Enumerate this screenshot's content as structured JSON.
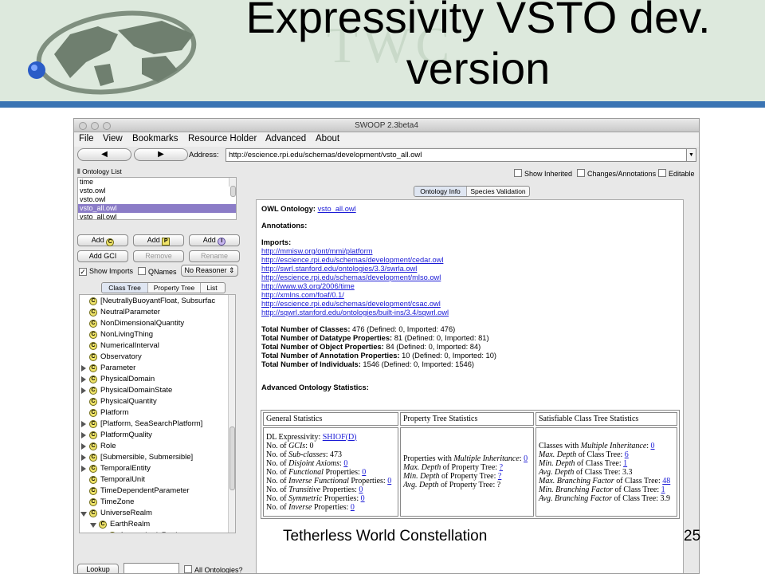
{
  "slide": {
    "title_line1": "Expressivity VSTO dev.",
    "title_line2": "version",
    "watermark": "TWC",
    "footer_left": "Tetherless World Constellation",
    "page_number": "25"
  },
  "window": {
    "title": "SWOOP 2.3beta4",
    "menu": [
      "File",
      "View",
      "Bookmarks",
      "Resource Holder",
      "Advanced",
      "About"
    ],
    "address_label": "Address:",
    "address_value": "http://escience.rpi.edu/schemas/development/vsto_all.owl"
  },
  "left_panel": {
    "ontology_list_label": "Ontology List",
    "ontologies": [
      "time",
      "vsto.owl",
      "vsto.owl",
      "vsto_all.owl",
      "vsto_all.owl"
    ],
    "selected_index": 3,
    "buttons": {
      "add_c": "Add",
      "add_p": "Add",
      "add_i": "Add",
      "add_gci": "Add GCI",
      "remove": "Remove",
      "rename": "Rename",
      "lookup": "Lookup"
    },
    "icons": {
      "c": "C",
      "p": "P",
      "i": "I"
    },
    "show_imports": "Show Imports",
    "qnames": "QNames",
    "reasoner": "No Reasoner",
    "tabs": [
      "Class Tree",
      "Property Tree",
      "List"
    ],
    "all_ontologies": "All Ontologies?",
    "tree": [
      {
        "label": "[NeutrallyBuoyantFloat, Subsurfac",
        "expandable": false
      },
      {
        "label": "NeutralParameter",
        "expandable": false
      },
      {
        "label": "NonDimensionalQuantity",
        "expandable": false
      },
      {
        "label": "NonLivingThing",
        "expandable": false
      },
      {
        "label": "NumericalInterval",
        "expandable": false
      },
      {
        "label": "Observatory",
        "expandable": false
      },
      {
        "label": "Parameter",
        "expandable": true
      },
      {
        "label": "PhysicalDomain",
        "expandable": true
      },
      {
        "label": "PhysicalDomainState",
        "expandable": true
      },
      {
        "label": "PhysicalQuantity",
        "expandable": false
      },
      {
        "label": "Platform",
        "expandable": false
      },
      {
        "label": "[Platform, SeaSearchPlatform]",
        "expandable": true
      },
      {
        "label": "PlatformQuality",
        "expandable": true
      },
      {
        "label": "Role",
        "expandable": true
      },
      {
        "label": "[Submersible, Submersible]",
        "expandable": true
      },
      {
        "label": "TemporalEntity",
        "expandable": true
      },
      {
        "label": "TemporalUnit",
        "expandable": false
      },
      {
        "label": "TimeDependentParameter",
        "expandable": false
      },
      {
        "label": "TimeZone",
        "expandable": false
      },
      {
        "label": "UniverseRealm",
        "expandable": "open"
      },
      {
        "label": "EarthRealm",
        "expandable": "open",
        "level": 1
      },
      {
        "label": "AtmosphericRealm",
        "expandable": true,
        "level": 2
      }
    ]
  },
  "right_panel": {
    "show_inherited": "Show Inherited",
    "changes_annotations": "Changes/Annotations",
    "editable": "Editable",
    "tabs": [
      "Ontology Info",
      "Species Validation"
    ],
    "owl_ontology_label": "OWL Ontology:",
    "owl_ontology_value": "vsto_all.owl",
    "annotations_label": "Annotations:",
    "imports_label": "Imports:",
    "imports": [
      "http://mmisw.org/ont/mmi/platform",
      "http://escience.rpi.edu/schemas/development/cedar.owl",
      "http://swrl.stanford.edu/ontologies/3.3/swrla.owl",
      "http://escience.rpi.edu/schemas/development/mlso.owl",
      "http://www.w3.org/2006/time",
      "http://xmlns.com/foaf/0.1/",
      "http://escience.rpi.edu/schemas/development/csac.owl",
      "http://sqwrl.stanford.edu/ontologies/built-ins/3.4/sqwrl.owl"
    ],
    "totals": [
      {
        "label": "Total Number of Classes:",
        "value": "476 (Defined: 0, Imported: 476)"
      },
      {
        "label": "Total Number of Datatype Properties:",
        "value": "81 (Defined: 0, Imported: 81)"
      },
      {
        "label": "Total Number of Object Properties:",
        "value": "84 (Defined: 0, Imported: 84)"
      },
      {
        "label": "Total Number of Annotation Properties:",
        "value": "10 (Defined: 0, Imported: 10)"
      },
      {
        "label": "Total Number of Individuals:",
        "value": "1546 (Defined: 0, Imported: 1546)"
      }
    ],
    "advanced_label": "Advanced Ontology Statistics:",
    "stats_headers": [
      "General Statistics",
      "Property Tree Statistics",
      "Satisfiable Class Tree Statistics"
    ],
    "general": {
      "dl_label": "DL Expressivity:",
      "dl_value": "SHIOF(D)",
      "no_of": "No. of",
      "gcis_label": "GCIs",
      "gcis_value": "0",
      "subclasses_label": "Sub-classes",
      "subclasses_value": "473",
      "disjoint_label": "Disjoint Axioms",
      "disjoint_value": "0",
      "functional_label": "Functional",
      "functional_value": "0",
      "inverse_functional_label": "Inverse Functional",
      "inverse_functional_value": "0",
      "transitive_label": "Transitive",
      "transitive_value": "0",
      "symmetric_label": "Symmetric",
      "symmetric_value": "0",
      "inverse_label": "Inverse",
      "inverse_value": "0",
      "properties_word": "Properties:"
    },
    "property_tree": {
      "multi_label": "Properties with",
      "multi_em": "Multiple Inheritance",
      "multi_value": "0",
      "max_label": "Max. Depth",
      "max_value": "?",
      "min_label": "Min. Depth",
      "min_value": "?",
      "avg_label": "Avg. Depth",
      "avg_value": "?",
      "of_property_tree": "of Property Tree:"
    },
    "class_tree": {
      "multi_label": "Classes with",
      "multi_em": "Multiple Inheritance",
      "multi_value": "0",
      "max_depth_label": "Max. Depth",
      "max_depth_value": "6",
      "min_depth_label": "Min. Depth",
      "min_depth_value": "1",
      "avg_depth_label": "Avg. Depth",
      "avg_depth_value": "3.3",
      "max_branch_label": "Max. Branching Factor",
      "max_branch_value": "48",
      "min_branch_label": "Min. Branching Factor",
      "min_branch_value": "1",
      "avg_branch_label": "Avg. Branching Factor",
      "avg_branch_value": "3.9",
      "of_class_tree": "of Class Tree:"
    }
  }
}
